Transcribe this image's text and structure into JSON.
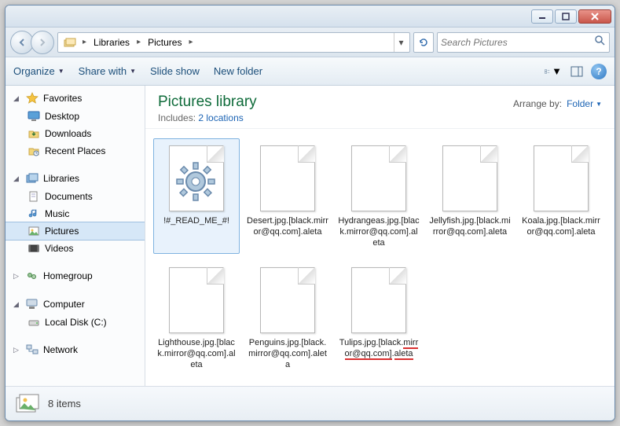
{
  "breadcrumb": {
    "seg1": "Libraries",
    "seg2": "Pictures"
  },
  "search": {
    "placeholder": "Search Pictures"
  },
  "toolbar": {
    "organize": "Organize",
    "share": "Share with",
    "slideshow": "Slide show",
    "newfolder": "New folder"
  },
  "nav": {
    "favorites": "Favorites",
    "desktop": "Desktop",
    "downloads": "Downloads",
    "recent": "Recent Places",
    "libraries": "Libraries",
    "documents": "Documents",
    "music": "Music",
    "pictures": "Pictures",
    "videos": "Videos",
    "homegroup": "Homegroup",
    "computer": "Computer",
    "localdisk": "Local Disk (C:)",
    "network": "Network"
  },
  "library": {
    "title": "Pictures library",
    "includes_prefix": "Includes:",
    "locations": "2 locations",
    "arrange_label": "Arrange by:",
    "arrange_value": "Folder"
  },
  "files": [
    {
      "name": "!#_READ_ME_#!",
      "selected": true,
      "gear": true
    },
    {
      "name": "Desert.jpg.[black.mirror@qq.com].aleta"
    },
    {
      "name": "Hydrangeas.jpg.[black.mirror@qq.com].aleta"
    },
    {
      "name": "Jellyfish.jpg.[black.mirror@qq.com].aleta"
    },
    {
      "name": "Koala.jpg.[black.mirror@qq.com].aleta"
    },
    {
      "name": "Lighthouse.jpg.[black.mirror@qq.com].aleta"
    },
    {
      "name": "Penguins.jpg.[black.mirror@qq.com].aleta"
    },
    {
      "name": "Tulips.jpg.[black.mirror@qq.com].aleta",
      "marked": true
    }
  ],
  "status": {
    "count": "8 items"
  }
}
